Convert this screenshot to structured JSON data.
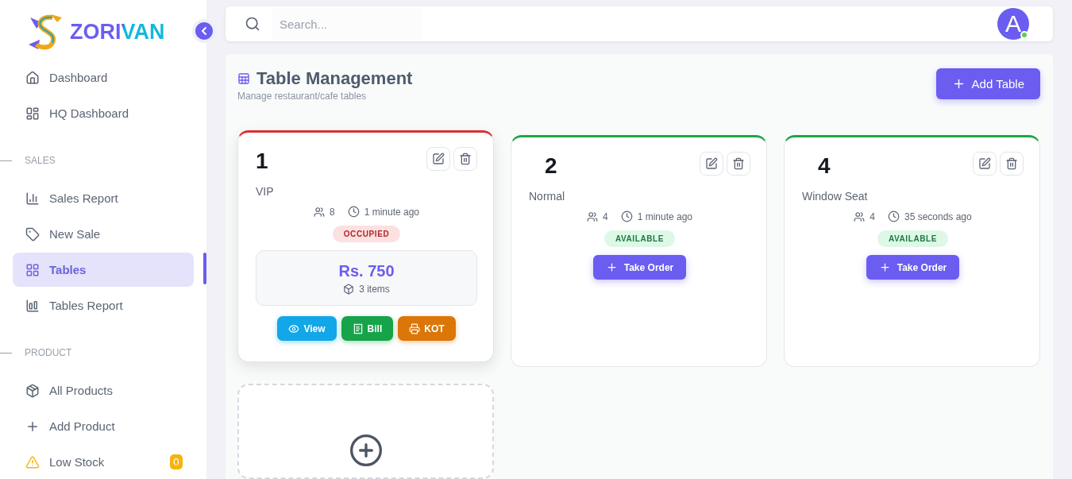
{
  "brand": {
    "name": "ZORIVAN"
  },
  "sidebar": {
    "sections": [
      {
        "items": [
          {
            "label": "Dashboard",
            "selected": false
          },
          {
            "label": "HQ Dashboard",
            "selected": false
          }
        ]
      },
      {
        "label": "SALES",
        "items": [
          {
            "label": "Sales Report",
            "selected": false
          },
          {
            "label": "New Sale",
            "selected": false
          },
          {
            "label": "Tables",
            "selected": true
          },
          {
            "label": "Tables Report",
            "selected": false
          }
        ]
      },
      {
        "label": "PRODUCT",
        "items": [
          {
            "label": "All Products",
            "selected": false
          },
          {
            "label": "Add Product",
            "selected": false
          },
          {
            "label": "Low Stock",
            "selected": false,
            "badge": "0"
          }
        ]
      }
    ]
  },
  "topbar": {
    "search": {
      "placeholder": "Search..."
    },
    "avatar": {
      "initial": "A",
      "online": true
    }
  },
  "page": {
    "title": "Table Management",
    "subtitle": "Manage restaurant/cafe tables",
    "add_button": "Add Table"
  },
  "tables": [
    {
      "number": "1",
      "type": "VIP",
      "guests": "8",
      "time": "1 minute ago",
      "kind": "occupied",
      "status_label": "OCCUPIED",
      "amount": "Rs. 750",
      "items": "3 items",
      "actions": [
        "View",
        "Bill",
        "KOT"
      ]
    },
    {
      "number": "2",
      "type": "Normal",
      "guests": "4",
      "time": "1 minute ago",
      "kind": "available",
      "status_label": "AVAILABLE",
      "order_button": "Take Order"
    },
    {
      "number": "4",
      "type": "Window Seat",
      "guests": "4",
      "time": "35 seconds ago",
      "kind": "available",
      "status_label": "AVAILABLE",
      "order_button": "Take Order"
    }
  ]
}
